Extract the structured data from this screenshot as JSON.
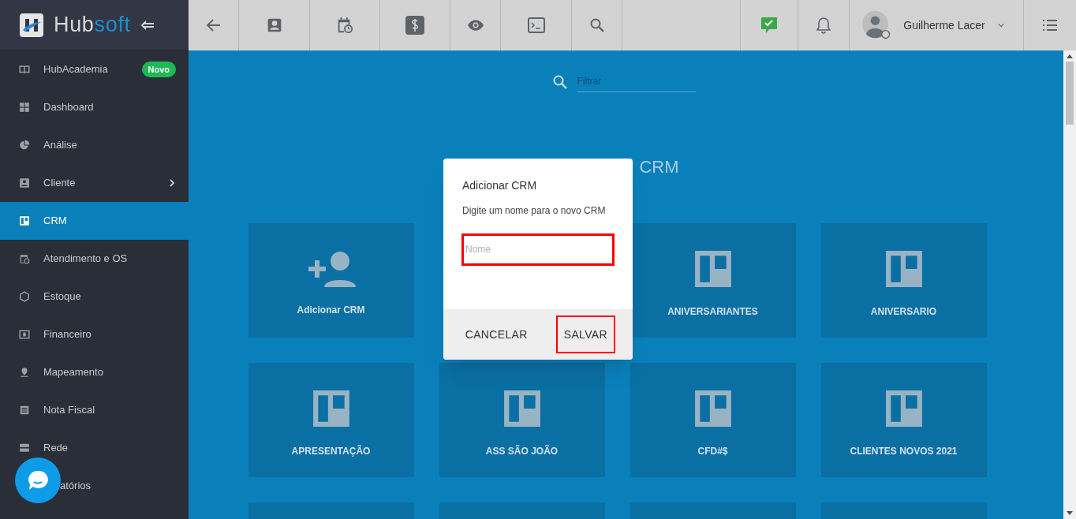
{
  "brand": {
    "name_left": "Hub",
    "name_right": "soft"
  },
  "toolbar": {
    "user_name": "Guilherme Lacer"
  },
  "sidebar": {
    "items": [
      {
        "label": "HubAcademia",
        "selected": false,
        "badge": "Novo"
      },
      {
        "label": "Dashboard",
        "selected": false
      },
      {
        "label": "Análise",
        "selected": false
      },
      {
        "label": "Cliente",
        "selected": false,
        "has_submenu": true
      },
      {
        "label": "CRM",
        "selected": true
      },
      {
        "label": "Atendimento e OS",
        "selected": false
      },
      {
        "label": "Estoque",
        "selected": false
      },
      {
        "label": "Financeiro",
        "selected": false
      },
      {
        "label": "Mapeamento",
        "selected": false
      },
      {
        "label": "Nota Fiscal",
        "selected": false
      },
      {
        "label": "Rede",
        "selected": false
      },
      {
        "label": "atórios",
        "selected": false
      }
    ]
  },
  "filter": {
    "placeholder": "Filtrar"
  },
  "heading": "CRM",
  "cards": [
    {
      "kind": "add",
      "label": "Adicionar CRM"
    },
    {
      "kind": "hidden"
    },
    {
      "kind": "board",
      "label": "ANIVERSARIANTES"
    },
    {
      "kind": "board",
      "label": "ANIVERSARIO"
    },
    {
      "kind": "board",
      "label": "APRESENTAÇÃO"
    },
    {
      "kind": "board",
      "label": "ASS SÃO JOÃO"
    },
    {
      "kind": "board",
      "label": "CFD#$"
    },
    {
      "kind": "board",
      "label": "CLIENTES NOVOS 2021"
    },
    {
      "kind": "cut"
    },
    {
      "kind": "cut"
    },
    {
      "kind": "cut"
    },
    {
      "kind": "cut"
    }
  ],
  "dialog": {
    "title": "Adicionar CRM",
    "message": "Digite um nome para o novo CRM",
    "field": {
      "placeholder": "Nome"
    },
    "buttons": [
      {
        "label": "CANCELAR",
        "highlighted": false
      },
      {
        "label": "SALVAR",
        "highlighted": true
      }
    ]
  }
}
